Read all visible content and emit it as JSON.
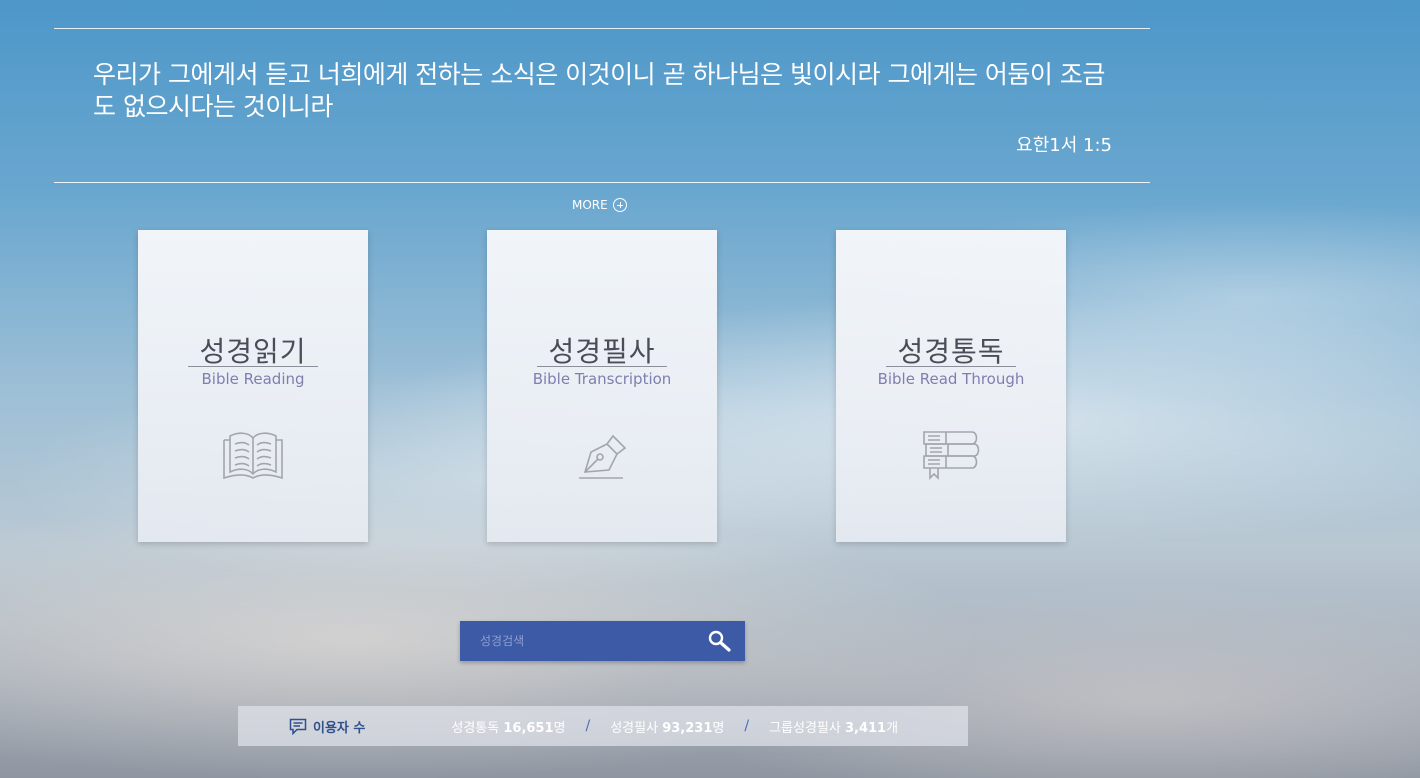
{
  "verse": {
    "text": "우리가 그에게서 듣고 너희에게 전하는 소식은 이것이니 곧 하나님은 빛이시라 그에게는 어둠이 조금도 없으시다는 것이니라",
    "reference": "요한1서 1:5"
  },
  "more_label": "MORE",
  "cards": [
    {
      "title": "성경읽기",
      "subtitle": "Bible Reading",
      "icon": "open-book-icon"
    },
    {
      "title": "성경필사",
      "subtitle": "Bible Transcription",
      "icon": "fountain-pen-icon"
    },
    {
      "title": "성경통독",
      "subtitle": "Bible Read Through",
      "icon": "stacked-books-icon"
    }
  ],
  "search": {
    "placeholder": "성경검색",
    "icon": "search-icon"
  },
  "stats": {
    "label": "이용자 수",
    "items": [
      {
        "name": "성경통독",
        "value": "16,651",
        "unit": "명"
      },
      {
        "name": "성경필사",
        "value": "93,231",
        "unit": "명"
      },
      {
        "name": "그룹성경필사",
        "value": "3,411",
        "unit": "개"
      }
    ]
  },
  "colors": {
    "accent": "#3d5aa6",
    "subtitle": "#7f7eb0"
  }
}
